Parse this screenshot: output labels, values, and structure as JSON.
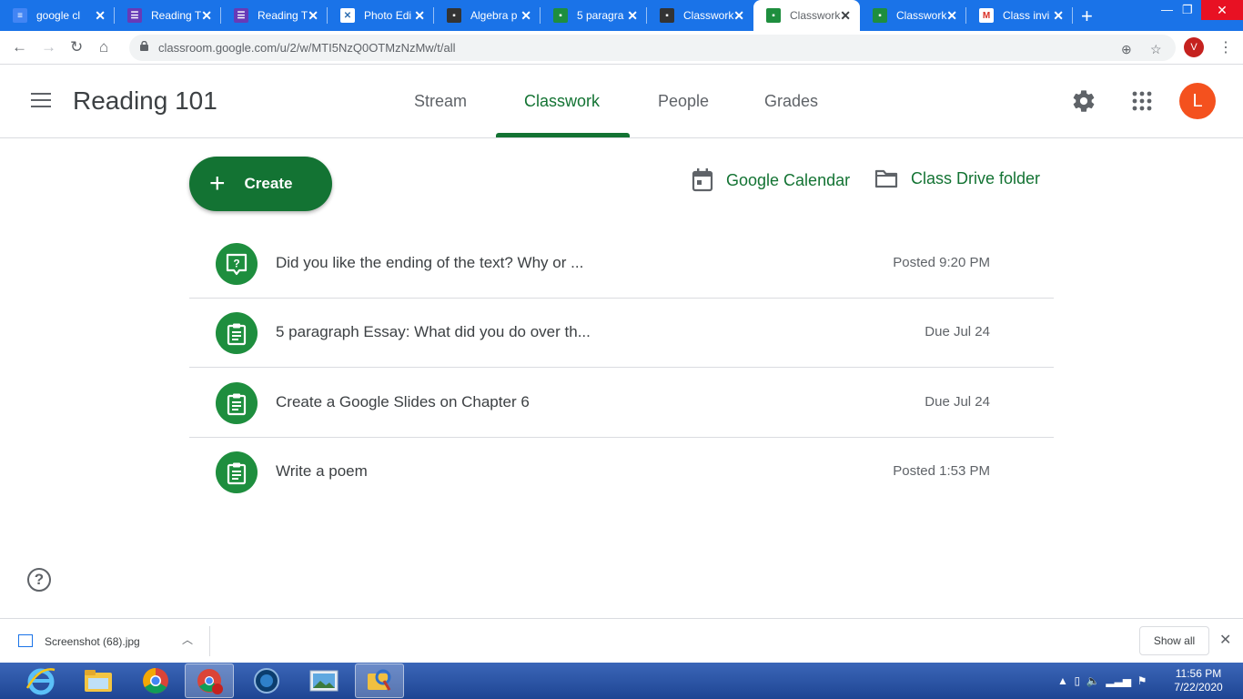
{
  "browser": {
    "tabs": [
      {
        "title": "google cl",
        "icon": "google-docs-icon",
        "color": "#4285f4"
      },
      {
        "title": "Reading T",
        "icon": "google-forms-icon",
        "color": "#673ab7"
      },
      {
        "title": "Reading T",
        "icon": "google-forms-icon",
        "color": "#673ab7"
      },
      {
        "title": "Photo Edi",
        "icon": "photo-editor-icon",
        "color": "#2b6cb0"
      },
      {
        "title": "Algebra p",
        "icon": "classroom-icon",
        "color": "#333333"
      },
      {
        "title": "5 paragra",
        "icon": "classroom-icon",
        "color": "#1e8e3e"
      },
      {
        "title": "Classwork",
        "icon": "classroom-icon",
        "color": "#333333"
      },
      {
        "title": "Classwork",
        "icon": "classroom-icon",
        "color": "#1e8e3e",
        "active": true
      },
      {
        "title": "Classwork",
        "icon": "classroom-icon",
        "color": "#1e8e3e"
      },
      {
        "title": "Class invi",
        "icon": "gmail-icon",
        "color": "#d93025"
      }
    ],
    "url": "classroom.google.com/u/2/w/MTI5NzQ0OTMzNzMw/t/all",
    "profile_initial": "V"
  },
  "classroom": {
    "class_name": "Reading 101",
    "nav": [
      "Stream",
      "Classwork",
      "People",
      "Grades"
    ],
    "active_nav": "Classwork",
    "avatar_initial": "L",
    "create_label": "Create",
    "calendar_label": "Google Calendar",
    "drive_label": "Class Drive folder",
    "items": [
      {
        "title": "Did you like the ending of the text? Why or ...",
        "meta": "Posted 9:20 PM",
        "type": "question"
      },
      {
        "title": "5 paragraph Essay: What did you do over th...",
        "meta": "Due Jul 24",
        "type": "assignment"
      },
      {
        "title": "Create a Google Slides on Chapter 6",
        "meta": "Due Jul 24",
        "type": "assignment"
      },
      {
        "title": "Write a poem",
        "meta": "Posted 1:53 PM",
        "type": "assignment"
      }
    ],
    "help_symbol": "?"
  },
  "downloads": {
    "file": "Screenshot (68).jpg",
    "show_all": "Show all"
  },
  "taskbar": {
    "time": "11:56 PM",
    "date": "7/22/2020"
  },
  "colors": {
    "accent": "#137333",
    "icon_bg": "#1e8e3e",
    "tabstrip": "#1a73e8",
    "avatar": "#f4511e"
  }
}
